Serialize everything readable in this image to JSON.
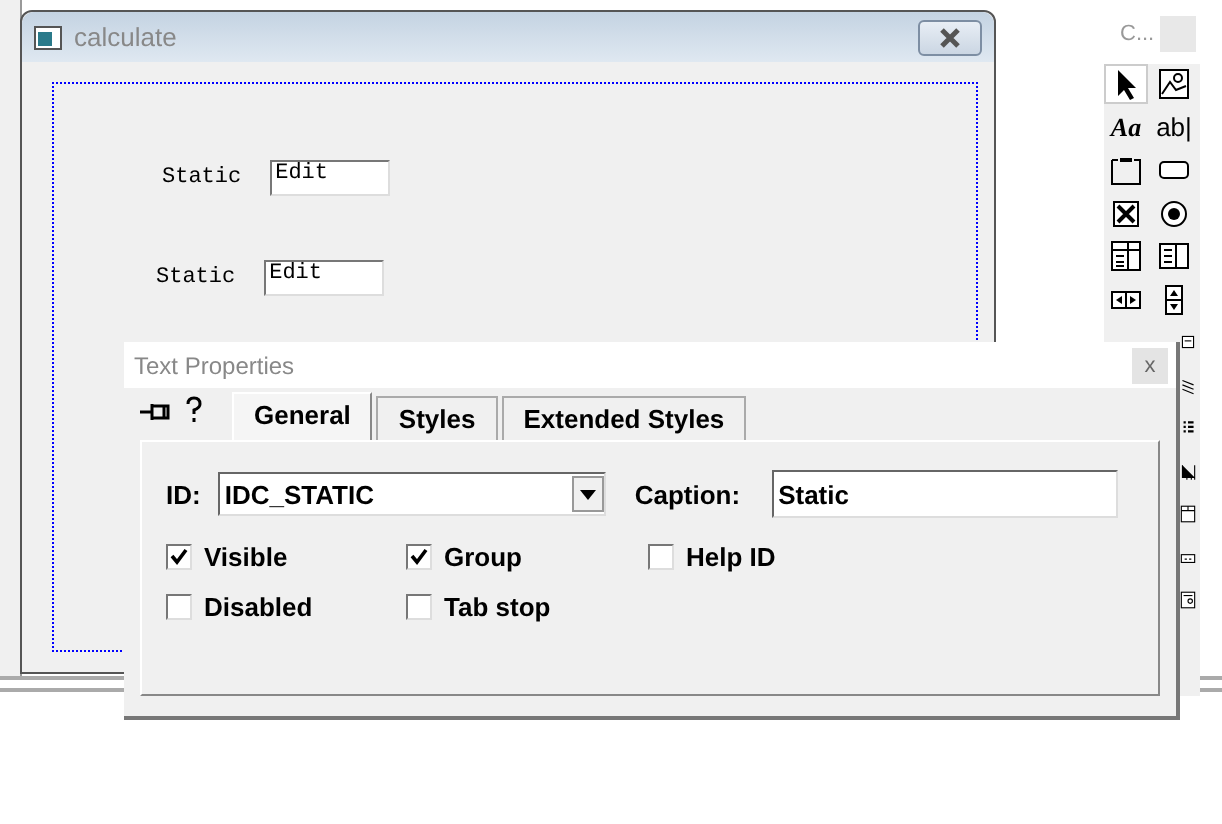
{
  "designer": {
    "title": "calculate",
    "controls": [
      {
        "label": "Static",
        "value": "Edit"
      },
      {
        "label": "Static",
        "value": "Edit"
      }
    ]
  },
  "toolbox": {
    "title": "C...",
    "tools": [
      {
        "kind": "pointer",
        "selected": true
      },
      {
        "kind": "picture",
        "selected": false
      },
      {
        "kind": "static",
        "glyph": "Aa",
        "selected": false
      },
      {
        "kind": "edit",
        "glyph": "ab|",
        "selected": false
      },
      {
        "kind": "group",
        "selected": false
      },
      {
        "kind": "button",
        "selected": false
      },
      {
        "kind": "check",
        "selected": false
      },
      {
        "kind": "radio",
        "selected": false
      },
      {
        "kind": "combo",
        "selected": false
      },
      {
        "kind": "list",
        "selected": false
      },
      {
        "kind": "hscroll",
        "selected": false
      },
      {
        "kind": "vscroll",
        "selected": false
      },
      {
        "kind": "spin",
        "selected": false
      },
      {
        "kind": "progress",
        "selected": false
      },
      {
        "kind": "hotkey",
        "selected": false
      },
      {
        "kind": "tree",
        "selected": false
      },
      {
        "kind": "slider",
        "selected": false
      },
      {
        "kind": "tab",
        "selected": false
      },
      {
        "kind": "animate",
        "selected": false
      }
    ]
  },
  "properties": {
    "title": "Text Properties",
    "close": "x",
    "tabs": [
      {
        "label": "General",
        "selected": true
      },
      {
        "label": "Styles",
        "selected": false
      },
      {
        "label": "Extended Styles",
        "selected": false
      }
    ],
    "id": {
      "label": "ID:",
      "value": "IDC_STATIC"
    },
    "caption": {
      "label": "Caption:",
      "value": "Static"
    },
    "options": [
      {
        "label": "Visible",
        "checked": true
      },
      {
        "label": "Group",
        "checked": true
      },
      {
        "label": "Help ID",
        "checked": false
      },
      {
        "label": "Disabled",
        "checked": false
      },
      {
        "label": "Tab stop",
        "checked": false
      }
    ]
  }
}
